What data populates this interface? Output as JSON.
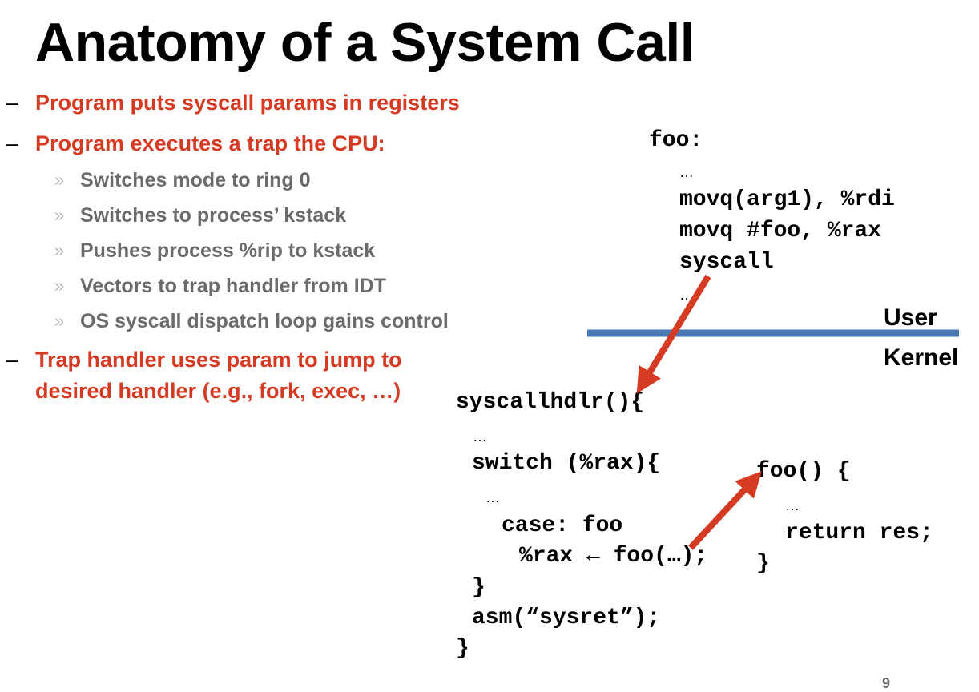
{
  "title": "Anatomy of a System Call",
  "bullets": [
    {
      "marker": "–",
      "text": "Program puts syscall params in registers"
    },
    {
      "marker": "–",
      "text": "Program executes a trap the CPU:"
    },
    {
      "marker": "–",
      "text": "Trap handler uses param to jump to",
      "text2": "desired handler (e.g., fork, exec, …)"
    }
  ],
  "sub_marker": "»",
  "sub_bullets": [
    "Switches mode to ring 0",
    "Switches to process’ kstack",
    "Pushes process %rip to kstack",
    "Vectors to trap handler from IDT",
    "OS syscall dispatch loop gains control"
  ],
  "user_code": {
    "label": "foo:",
    "ellipsis1": "…",
    "line1": "movq(arg1), %rdi",
    "line2": "movq #foo, %rax",
    "line3": "syscall",
    "ellipsis2": "…"
  },
  "boundary": {
    "user_label": "User",
    "kernel_label": "Kernel",
    "line_color": "#4a78b5"
  },
  "handler_code": {
    "header": "syscallhdlr(){",
    "ellipsis1": "…",
    "switch": "switch (%rax){",
    "ellipsis2": "…",
    "case": "case: foo",
    "assign": "%rax ← foo(…);",
    "close_switch": "}",
    "asm": "asm(“sysret”);",
    "close": "}"
  },
  "foo_code": {
    "header": "foo() {",
    "ellipsis": "…",
    "ret": "return res;",
    "close": "}"
  },
  "arrow_color": "#d53a22",
  "page_number": "9"
}
